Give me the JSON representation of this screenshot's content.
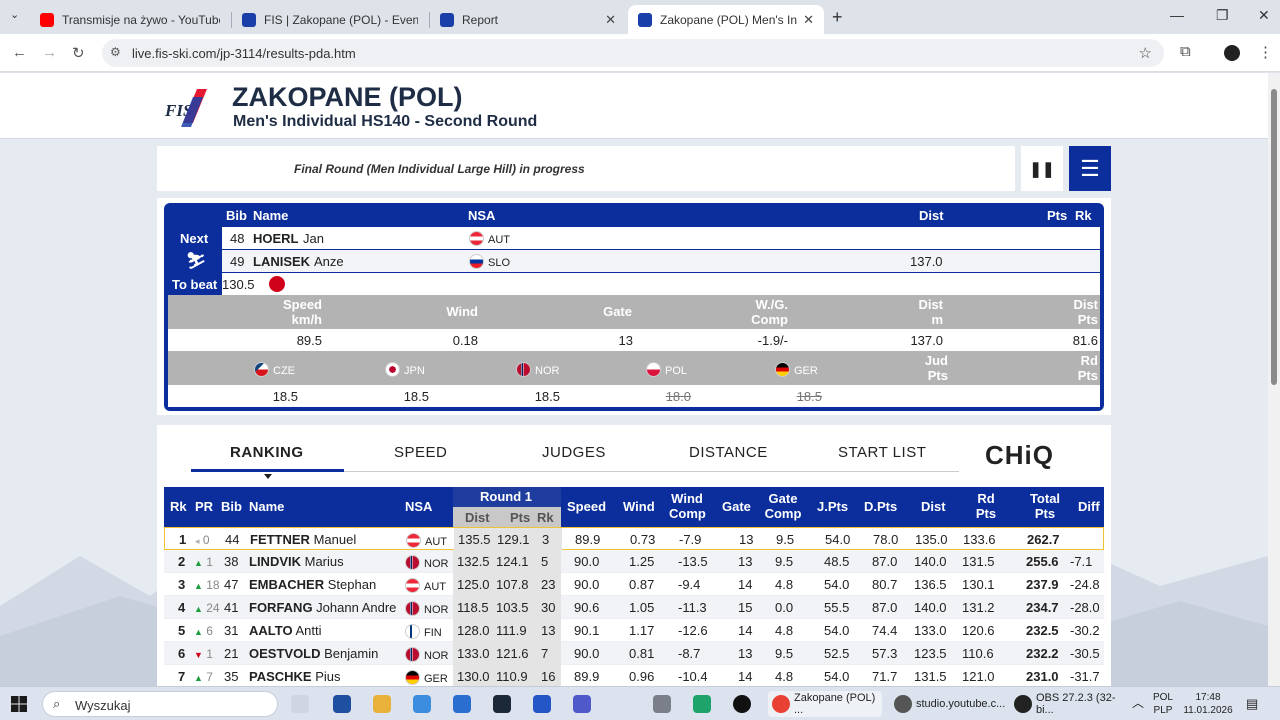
{
  "browser": {
    "tabs": [
      {
        "title": "Transmisje na żywo - YouTube Studio",
        "color": "#ff0000"
      },
      {
        "title": "FIS | Zakopane (POL) - Event Details",
        "color": "#1a3fa8"
      },
      {
        "title": "Report",
        "color": "#1a3fa8"
      },
      {
        "title": "Zakopane (POL) Men's Individual",
        "color": "#1a3fa8"
      }
    ],
    "url": "live.fis-ski.com/jp-3114/results-pda.htm"
  },
  "header": {
    "title": "ZAKOPANE (POL)",
    "subtitle": "Men's Individual HS140 - Second Round",
    "logo": "FIS"
  },
  "status": {
    "text": "Final Round (Men Individual Large Hill) in progress"
  },
  "current": {
    "headers": {
      "bib": "Bib",
      "name": "Name",
      "nsa": "NSA",
      "dist": "Dist",
      "pts": "Pts",
      "rk": "Rk"
    },
    "next_label": "Next",
    "to_beat_label": "To beat",
    "next": {
      "bib": "48",
      "last": "HOERL",
      "first": "Jan",
      "nsa": "AUT"
    },
    "jumper": {
      "bib": "49",
      "last": "LANISEK",
      "first": "Anze",
      "nsa": "SLO",
      "dist": "137.0"
    },
    "to_beat": "130.5",
    "detail_headers": {
      "speed": [
        "Speed",
        "km/h"
      ],
      "wind": "Wind",
      "gate": "Gate",
      "wg": [
        "W./G.",
        "Comp"
      ],
      "dist": [
        "Dist",
        "m"
      ],
      "distpts": [
        "Dist",
        "Pts"
      ]
    },
    "detail_values": {
      "speed": "89.5",
      "wind": "0.18",
      "gate": "13",
      "wg": "-1.9/-",
      "dist": "137.0",
      "distpts": "81.6"
    },
    "judges": [
      {
        "nsa": "CZE",
        "score": "18.5",
        "struck": false
      },
      {
        "nsa": "JPN",
        "score": "18.5",
        "struck": false
      },
      {
        "nsa": "NOR",
        "score": "18.5",
        "struck": false
      },
      {
        "nsa": "POL",
        "score": "18.0",
        "struck": true
      },
      {
        "nsa": "GER",
        "score": "18.5",
        "struck": true
      }
    ],
    "jud_pts": [
      "Jud",
      "Pts"
    ],
    "rd_pts": [
      "Rd",
      "Pts"
    ]
  },
  "ranking_tabs": [
    "RANKING",
    "SPEED",
    "JUDGES",
    "DISTANCE",
    "START LIST"
  ],
  "sponsor": "CHiQ",
  "table": {
    "headers": {
      "rk": "Rk",
      "pr": "PR",
      "bib": "Bib",
      "name": "Name",
      "nsa": "NSA",
      "round1": "Round 1",
      "r1dist": "Dist",
      "r1pts": "Pts",
      "r1rk": "Rk",
      "speed": "Speed",
      "wind": "Wind",
      "windcomp": [
        "Wind",
        "Comp"
      ],
      "gate": "Gate",
      "gatecomp": [
        "Gate",
        "Comp"
      ],
      "jpts": "J.Pts",
      "dpts": "D.Pts",
      "dist": "Dist",
      "rdpts": [
        "Rd",
        "Pts"
      ],
      "total": [
        "Total",
        "Pts"
      ],
      "diff": "Diff"
    },
    "rows": [
      {
        "rk": "1",
        "trend": "same",
        "pr": "0",
        "bib": "44",
        "last": "FETTNER",
        "first": "Manuel",
        "nsa": "AUT",
        "r1dist": "135.5",
        "r1pts": "129.1",
        "r1rk": "3",
        "speed": "89.9",
        "wind": "0.73",
        "windcomp": "-7.9",
        "gate": "13",
        "gatecomp": "9.5",
        "jpts": "54.0",
        "dpts": "78.0",
        "dist": "135.0",
        "rdpts": "133.6",
        "total": "262.7",
        "diff": ""
      },
      {
        "rk": "2",
        "trend": "up",
        "pr": "1",
        "bib": "38",
        "last": "LINDVIK",
        "first": "Marius",
        "nsa": "NOR",
        "r1dist": "132.5",
        "r1pts": "124.1",
        "r1rk": "5",
        "speed": "90.0",
        "wind": "1.25",
        "windcomp": "-13.5",
        "gate": "13",
        "gatecomp": "9.5",
        "jpts": "48.5",
        "dpts": "87.0",
        "dist": "140.0",
        "rdpts": "131.5",
        "total": "255.6",
        "diff": "-7.1"
      },
      {
        "rk": "3",
        "trend": "up",
        "pr": "18",
        "bib": "47",
        "last": "EMBACHER",
        "first": "Stephan",
        "nsa": "AUT",
        "r1dist": "125.0",
        "r1pts": "107.8",
        "r1rk": "23",
        "speed": "90.0",
        "wind": "0.87",
        "windcomp": "-9.4",
        "gate": "14",
        "gatecomp": "4.8",
        "jpts": "54.0",
        "dpts": "80.7",
        "dist": "136.5",
        "rdpts": "130.1",
        "total": "237.9",
        "diff": "-24.8"
      },
      {
        "rk": "4",
        "trend": "up",
        "pr": "24",
        "bib": "41",
        "last": "FORFANG",
        "first": "Johann Andre",
        "nsa": "NOR",
        "r1dist": "118.5",
        "r1pts": "103.5",
        "r1rk": "30",
        "speed": "90.6",
        "wind": "1.05",
        "windcomp": "-11.3",
        "gate": "15",
        "gatecomp": "0.0",
        "jpts": "55.5",
        "dpts": "87.0",
        "dist": "140.0",
        "rdpts": "131.2",
        "total": "234.7",
        "diff": "-28.0"
      },
      {
        "rk": "5",
        "trend": "up",
        "pr": "6",
        "bib": "31",
        "last": "AALTO",
        "first": "Antti",
        "nsa": "FIN",
        "r1dist": "128.0",
        "r1pts": "111.9",
        "r1rk": "13",
        "speed": "90.1",
        "wind": "1.17",
        "windcomp": "-12.6",
        "gate": "14",
        "gatecomp": "4.8",
        "jpts": "54.0",
        "dpts": "74.4",
        "dist": "133.0",
        "rdpts": "120.6",
        "total": "232.5",
        "diff": "-30.2"
      },
      {
        "rk": "6",
        "trend": "down",
        "pr": "1",
        "bib": "21",
        "last": "OESTVOLD",
        "first": "Benjamin",
        "nsa": "NOR",
        "r1dist": "133.0",
        "r1pts": "121.6",
        "r1rk": "7",
        "speed": "90.0",
        "wind": "0.81",
        "windcomp": "-8.7",
        "gate": "13",
        "gatecomp": "9.5",
        "jpts": "52.5",
        "dpts": "57.3",
        "dist": "123.5",
        "rdpts": "110.6",
        "total": "232.2",
        "diff": "-30.5"
      },
      {
        "rk": "7",
        "trend": "up",
        "pr": "7",
        "bib": "35",
        "last": "PASCHKE",
        "first": "Pius",
        "nsa": "GER",
        "r1dist": "130.0",
        "r1pts": "110.9",
        "r1rk": "16",
        "speed": "89.9",
        "wind": "0.96",
        "windcomp": "-10.4",
        "gate": "14",
        "gatecomp": "4.8",
        "jpts": "54.0",
        "dpts": "71.7",
        "dist": "131.5",
        "rdpts": "121.0",
        "total": "231.0",
        "diff": "-31.7"
      }
    ]
  },
  "taskbar": {
    "search_placeholder": "Wyszukaj",
    "apps": [
      {
        "label": "Zakopane (POL) ..."
      },
      {
        "label": "studio.youtube.c..."
      },
      {
        "label": "OBS 27.2.3 (32-bi..."
      }
    ],
    "lang_top": "POL",
    "lang_bottom": "PLP",
    "time": "17:48",
    "date": "11.01.2026"
  },
  "colors": {
    "accent": "#0b2e9c",
    "trend_up": "#1b9e3b",
    "trend_down": "#d0021b",
    "first_border": "#f1c232"
  },
  "flags": {
    "AUT": "linear-gradient(#ed2939 33%, #fff 33%, #fff 66%, #ed2939 66%)",
    "SLO": "linear-gradient(#fff 33%, #0033a0 33%, #0033a0 66%, #ed1c24 66%)",
    "NOR": "linear-gradient(90deg, #ba0c2f 30%, #fff 30%, #fff 34%, #00205b 34%, #00205b 46%, #fff 46%, #fff 50%, #ba0c2f 50%)",
    "FIN": "linear-gradient(90deg, #fff 30%, #003580 30%, #003580 46%, #fff 46%)",
    "GER": "linear-gradient(#000 33%, #dd0000 33%, #dd0000 66%, #ffce00 66%)",
    "POL": "linear-gradient(#fff 50%, #dc143c 50%)",
    "CZE": "linear-gradient(135deg, #11457e 35%, transparent 35%), linear-gradient(#fff 50%, #d7141a 50%)",
    "JPN": "radial-gradient(circle, #bc002d 35%, #fff 37%)"
  }
}
